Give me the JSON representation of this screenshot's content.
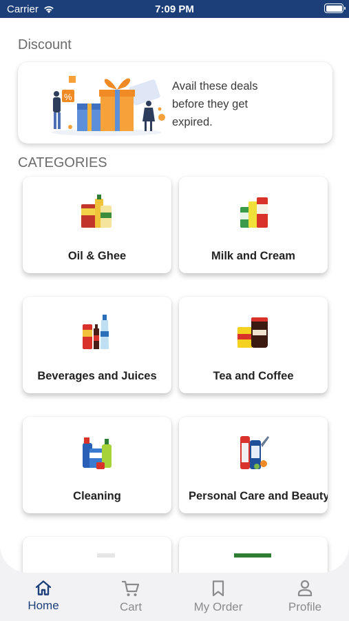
{
  "status_bar": {
    "carrier": "Carrier",
    "time": "7:09 PM"
  },
  "discount": {
    "title": "Discount",
    "text": "Avail these deals before they get expired."
  },
  "categories": {
    "title": "CATEGORIES",
    "items": [
      {
        "label": "Oil & Ghee",
        "icon": "oil-ghee-products"
      },
      {
        "label": "Milk and Cream",
        "icon": "milk-cream-products"
      },
      {
        "label": "Beverages and Juices",
        "icon": "beverage-bottles"
      },
      {
        "label": "Tea and Coffee",
        "icon": "tea-coffee-products"
      },
      {
        "label": "Cleaning",
        "icon": "cleaning-products"
      },
      {
        "label": "Personal Care and Beauty",
        "icon": "personal-care-products"
      }
    ]
  },
  "tab_bar": {
    "items": [
      {
        "label": "Home",
        "icon": "home-icon",
        "active": true
      },
      {
        "label": "Cart",
        "icon": "cart-icon",
        "active": false
      },
      {
        "label": "My Order",
        "icon": "bookmark-icon",
        "active": false
      },
      {
        "label": "Profile",
        "icon": "person-icon",
        "active": false
      }
    ]
  },
  "colors": {
    "brand": "#1c3f7a",
    "inactive_tab": "#8a8a8a",
    "card_bg": "#ffffff",
    "background": "#f2f2f4"
  }
}
